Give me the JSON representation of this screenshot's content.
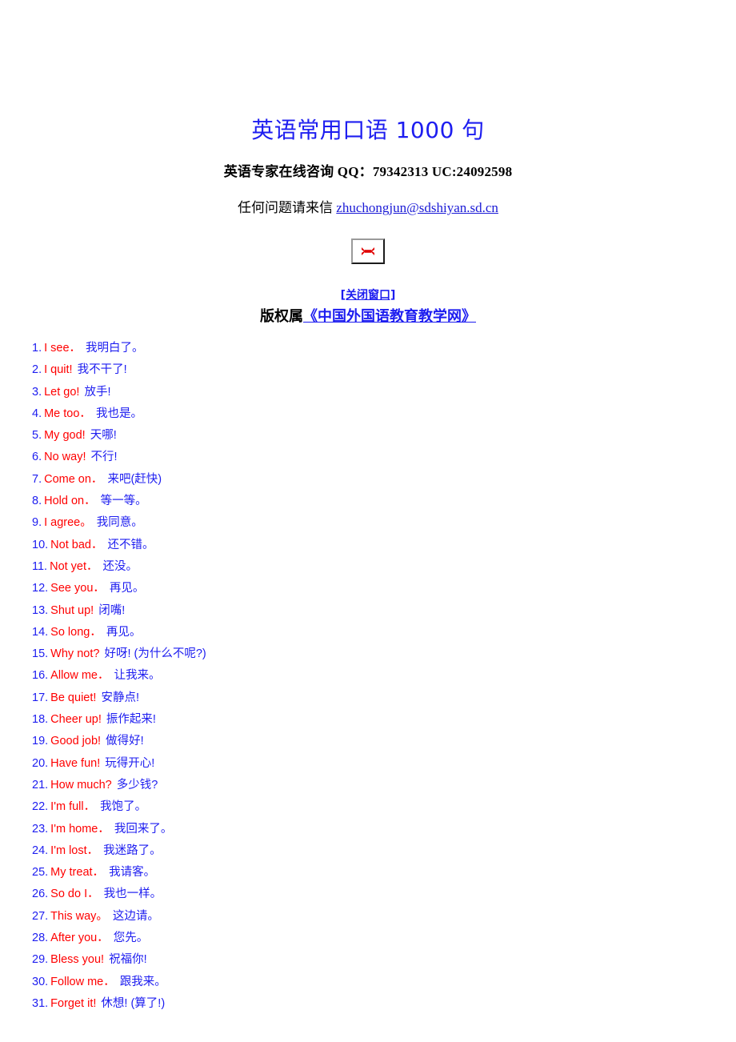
{
  "header": {
    "title": "英语常用口语 1000 句",
    "qq_line": "英语专家在线咨询 QQ：79342313  UC:24092598",
    "mail_label": "任何问题请来信 ",
    "mail_link": "zhuchongjun@sdshiyan.sd.cn",
    "broken_image_icon": "broken-image-icon",
    "close_window_link": "[关闭窗口]",
    "copyright_prefix": "版权属",
    "copyright_site": "《中国外国语教育教学网》"
  },
  "colors": {
    "title_blue": "#1d1df0",
    "link_blue": "#1d1df0",
    "english_red": "#ff0000",
    "chinese_blue": "#1d1df0",
    "text_black": "#000000",
    "page_background": "#ffffff"
  },
  "phrases": [
    {
      "index": "1.",
      "en": "I see．",
      "zh": "我明白了。"
    },
    {
      "index": "2.",
      "en": "I quit!",
      "zh": "我不干了!"
    },
    {
      "index": "3.",
      "en": "Let go!",
      "zh": "放手!"
    },
    {
      "index": "4.",
      "en": "Me too．",
      "zh": "我也是。"
    },
    {
      "index": "5.",
      "en": "My god!",
      "zh": "天哪!"
    },
    {
      "index": "6.",
      "en": "No way!",
      "zh": "不行!"
    },
    {
      "index": "7.",
      "en": "Come on．",
      "zh": "来吧(赶快)"
    },
    {
      "index": "8.",
      "en": "Hold on．",
      "zh": "等一等。"
    },
    {
      "index": "9.",
      "en": "I agree。",
      "zh": "我同意。"
    },
    {
      "index": "10.",
      "en": "Not bad．",
      "zh": "还不错。"
    },
    {
      "index": "11.",
      "en": "Not yet．",
      "zh": "还没。"
    },
    {
      "index": "12.",
      "en": "See you．",
      "zh": "再见。"
    },
    {
      "index": "13.",
      "en": "Shut up!",
      "zh": "闭嘴!"
    },
    {
      "index": "14.",
      "en": "So long．",
      "zh": "再见。"
    },
    {
      "index": "15.",
      "en": "Why not?",
      "zh": "好呀! (为什么不呢?)"
    },
    {
      "index": "16.",
      "en": "Allow me．",
      "zh": "让我来。"
    },
    {
      "index": "17.",
      "en": "Be quiet!",
      "zh": "安静点!"
    },
    {
      "index": "18.",
      "en": "Cheer up!",
      "zh": "振作起来!"
    },
    {
      "index": "19.",
      "en": "Good job!",
      "zh": "做得好!"
    },
    {
      "index": "20.",
      "en": "Have fun!",
      "zh": "玩得开心!"
    },
    {
      "index": "21.",
      "en": "How much?",
      "zh": "多少钱?"
    },
    {
      "index": "22.",
      "en": "I'm full．",
      "zh": "我饱了。"
    },
    {
      "index": "23.",
      "en": "I'm home．",
      "zh": "我回来了。"
    },
    {
      "index": "24.",
      "en": "I'm lost．",
      "zh": "我迷路了。"
    },
    {
      "index": "25.",
      "en": "My treat．",
      "zh": "我请客。"
    },
    {
      "index": "26.",
      "en": "So do I．",
      "zh": "我也一样。"
    },
    {
      "index": "27.",
      "en": "This way。",
      "zh": "这边请。"
    },
    {
      "index": "28.",
      "en": "After you．",
      "zh": "您先。"
    },
    {
      "index": "29.",
      "en": "Bless you!",
      "zh": "祝福你!"
    },
    {
      "index": "30.",
      "en": "Follow me．",
      "zh": "跟我来。"
    },
    {
      "index": "31.",
      "en": "Forget it!",
      "zh": "休想! (算了!)"
    }
  ]
}
